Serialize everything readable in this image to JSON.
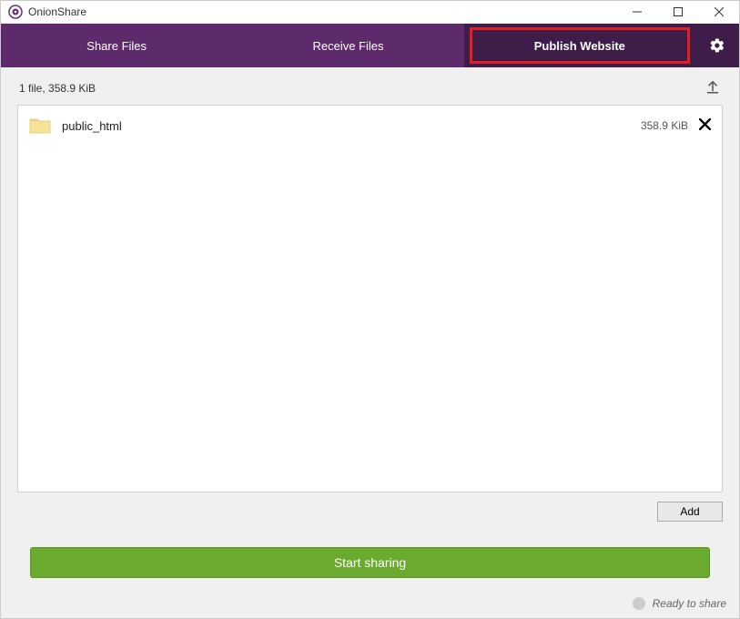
{
  "window": {
    "title": "OnionShare"
  },
  "tabs": {
    "items": [
      {
        "label": "Share Files",
        "active": false
      },
      {
        "label": "Receive Files",
        "active": false
      },
      {
        "label": "Publish Website",
        "active": true
      }
    ]
  },
  "summary": {
    "text": "1 file, 358.9 KiB"
  },
  "files": [
    {
      "name": "public_html",
      "size": "358.9 KiB"
    }
  ],
  "buttons": {
    "add": "Add",
    "start": "Start sharing"
  },
  "status": {
    "text": "Ready to share"
  }
}
